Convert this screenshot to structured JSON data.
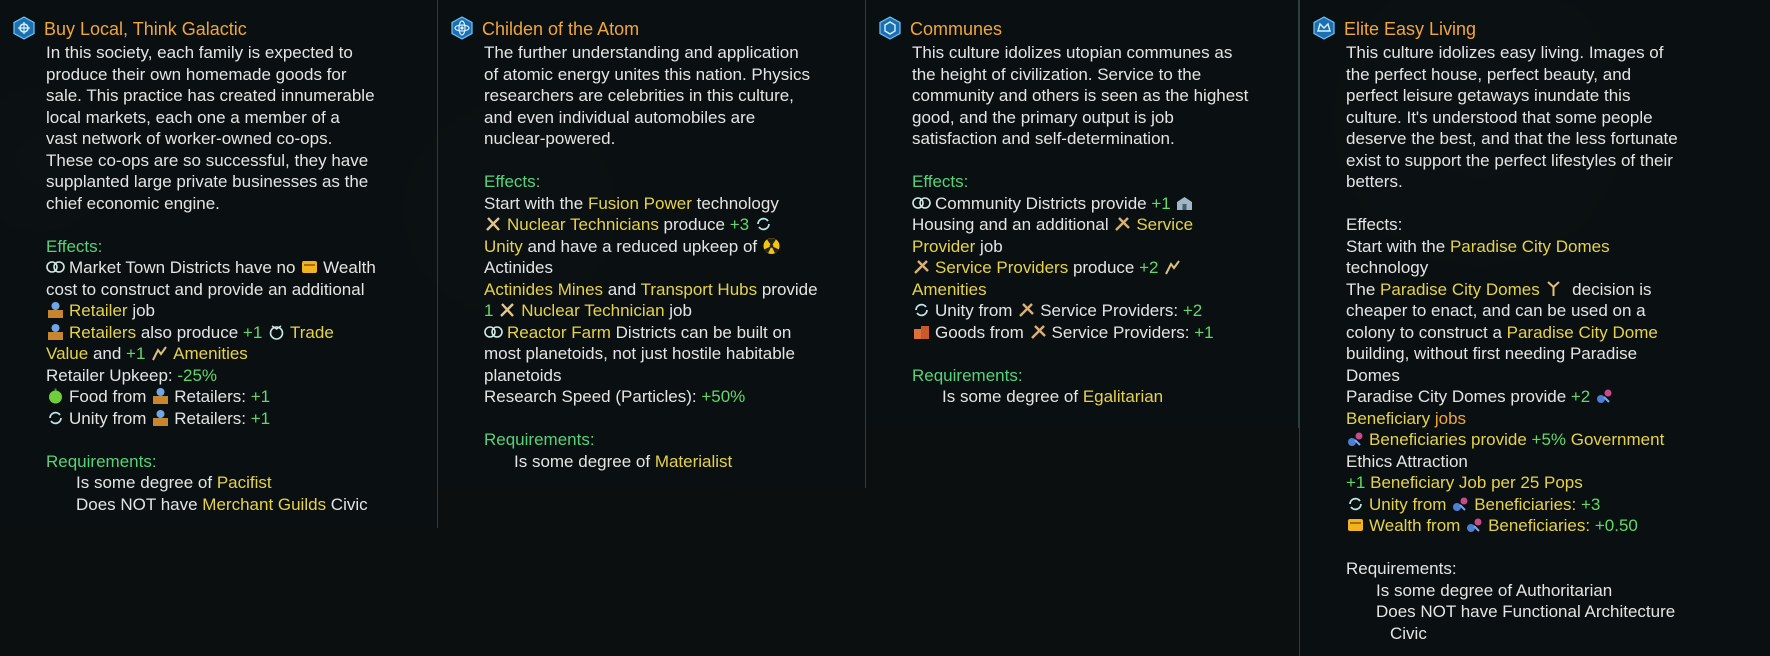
{
  "colors": {
    "title": "#f0a63a",
    "header": "#56d27a",
    "highlight": "#e6d24a",
    "positive": "#62d86a",
    "border": "#46645f"
  },
  "cards": [
    {
      "title": "Buy Local, Think Galactic",
      "icon": "galaxy-emblem-icon",
      "description": [
        "In this society, each family is expected to",
        "produce their own homemade goods for",
        "sale. This practice has created innumerable",
        "local markets, each one a member of a",
        "vast network of worker-owned co-ops.",
        "These co-ops are so successful, they have",
        "supplanted large private businesses as the",
        "chief economic engine."
      ],
      "effects_header": "Effects:",
      "effects": {
        "l1a": "Market Town Districts have no",
        "l1b": "Wealth",
        "l2": "cost to construct and provide an additional",
        "l3a": "Retailer",
        "l3b": " job",
        "l4a": "Retailers",
        "l4b": " also produce ",
        "l4c": "+1",
        "l4d": "Trade",
        "l5a": "Value",
        "l5b": " and ",
        "l5c": "+1",
        "l5d": "Amenities",
        "l6a": "Retailer Upkeep: ",
        "l6b": "-25%",
        "l7a": "Food from",
        "l7b": "Retailers: ",
        "l7c": "+1",
        "l8a": "Unity from",
        "l8b": "Retailers: ",
        "l8c": "+1"
      },
      "requirements_header": "Requirements:",
      "requirements": {
        "r1a": "Is some degree of ",
        "r1b": "Pacifist",
        "r2a": "Does NOT have ",
        "r2b": "Merchant Guilds",
        "r2c": " Civic"
      }
    },
    {
      "title": "Childen of the Atom",
      "icon": "atom-emblem-icon",
      "description": [
        "The further understanding and application",
        "of atomic energy unites this nation. Physics",
        "researchers are celebrities in this culture,",
        "and even individual automobiles are",
        "nuclear-powered."
      ],
      "effects_header": "Effects:",
      "effects": {
        "l1a": "Start with the ",
        "l1b": "Fusion Power",
        "l1c": " technology",
        "l2a": "Nuclear Technicians",
        "l2b": " produce ",
        "l2c": "+3",
        "l3a": "Unity",
        "l3b": " and have a reduced upkeep of",
        "l4": "Actinides",
        "l5a": "Actinides Mines",
        "l5b": " and ",
        "l5c": "Transport Hubs",
        "l5d": " provide",
        "l6a": "1",
        "l6b": "Nuclear Technician",
        "l6c": " job",
        "l7a": "Reactor Farm",
        "l7b": " Districts can be built on",
        "l8": "most planetoids, not just hostile habitable",
        "l9": "planetoids",
        "l10a": "Research Speed (Particles): ",
        "l10b": "+50%"
      },
      "requirements_header": "Requirements:",
      "requirements": {
        "r1a": "Is some degree of ",
        "r1b": "Materialist"
      }
    },
    {
      "title": "Communes",
      "icon": "commune-emblem-icon",
      "description": [
        "This culture idolizes utopian communes as",
        "the height of civilization. Service to the",
        "community and others is seen as the highest",
        "good, and the primary output is job",
        "satisfaction and self-determination."
      ],
      "effects_header": "Effects:",
      "effects": {
        "l1a": "Community Districts provide ",
        "l1b": "+1",
        "l2a": "Housing and an additional",
        "l2b": "Service",
        "l3a": "Provider",
        "l3b": " job",
        "l4a": "Service Providers",
        "l4b": " produce ",
        "l4c": "+2",
        "l5": "Amenities",
        "l6a": "Unity from",
        "l6b": "Service Providers: ",
        "l6c": "+2",
        "l7a": "Goods from",
        "l7b": "Service Providers: ",
        "l7c": "+1"
      },
      "requirements_header": "Requirements:",
      "requirements": {
        "r1a": "Is some degree of ",
        "r1b": "Egalitarian"
      }
    },
    {
      "title": "Elite Easy Living",
      "icon": "elite-emblem-icon",
      "description": [
        "This culture idolizes easy living. Images of",
        "the perfect house, perfect beauty, and",
        "perfect leisure getaways inundate this",
        "culture. It's understood that some people",
        "deserve the best, and that the less fortunate",
        "exist to support the perfect lifestyles of their",
        "betters."
      ],
      "effects_header": "Effects:",
      "effects": {
        "l1a": "Start with the ",
        "l1b": "Paradise City Domes",
        "l2": "technology",
        "l3a": " The ",
        "l3b": "Paradise City Domes",
        "l3c": " decision is",
        "l4": "cheaper to enact, and can be used on a",
        "l5a": "colony to construct a ",
        "l5b": "Paradise City Dome",
        "l6": "building, without first needing Paradise",
        "l7": "Domes",
        "l8a": "Paradise City Domes provide ",
        "l8b": "+2",
        "l9a": "Beneficiary",
        "l9b": " jobs",
        "l10a": "Beneficiaries provide ",
        "l10b": "+5%",
        "l10c": " Government",
        "l11": "Ethics Attraction",
        "l12a": "+1",
        "l12b": " Beneficiary Job per 25 Pops",
        "l13a": "Unity from",
        "l13b": "Beneficiaries: ",
        "l13c": "+3",
        "l14a": "Wealth from",
        "l14b": "Beneficiaries: ",
        "l14c": "+0.50"
      },
      "requirements_header": "Requirements:",
      "requirements": {
        "r1a": "Is some degree of ",
        "r1b": "Authoritarian",
        "r2a": "Does NOT have ",
        "r2b": "Functional Architecture",
        "r3": "Civic"
      }
    }
  ]
}
